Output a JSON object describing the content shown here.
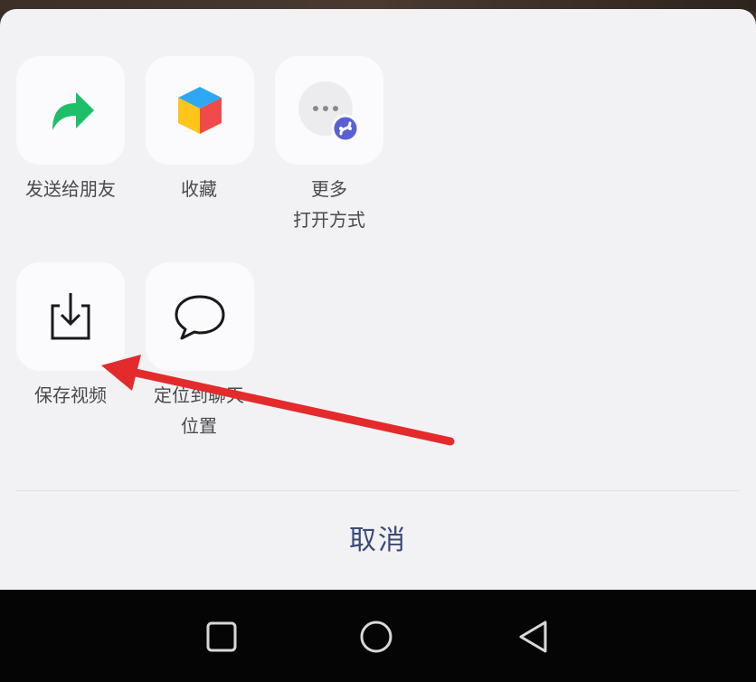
{
  "share_sheet": {
    "row1": [
      {
        "label": "发送给朋友",
        "icon": "share-forward-icon"
      },
      {
        "label": "收藏",
        "icon": "favorite-cube-icon"
      },
      {
        "label_line1": "更多",
        "label_line2": "打开方式",
        "icon": "more-open-icon"
      }
    ],
    "row2": [
      {
        "label": "保存视频",
        "icon": "save-download-icon"
      },
      {
        "label_line1": "定位到聊天",
        "label_line2": "位置",
        "icon": "chat-bubble-icon"
      }
    ],
    "cancel_label": "取消"
  },
  "nav_bar": {
    "buttons": [
      "recent-apps-square-icon",
      "home-circle-icon",
      "back-triangle-icon"
    ]
  },
  "colors": {
    "sheet_bg": "#f2f2f5",
    "tile_bg": "#fbfbfd",
    "share_green": "#1fbf6a",
    "cancel_text": "#3a4a78",
    "annotation_red": "#e32b2b"
  }
}
